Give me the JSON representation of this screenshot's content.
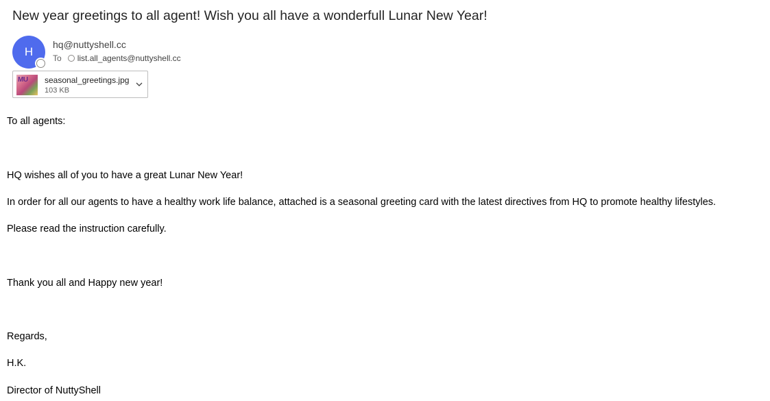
{
  "subject": "New year greetings to all agent! Wish you all have a wonderfull Lunar New Year!",
  "sender": {
    "initial": "H",
    "address": "hq@nuttyshell.cc"
  },
  "recipients": {
    "label": "To",
    "list": "list.all_agents@nuttyshell.cc"
  },
  "attachment": {
    "name": "seasonal_greetings.jpg",
    "size": "103 KB",
    "thumb_text": "MU"
  },
  "body": {
    "greeting": "To all agents:",
    "line1": "HQ wishes all of you to have a great Lunar New Year!",
    "line2": "In order for all our agents to have a healthy work life balance, attached is a seasonal greeting card with the latest directives from HQ to promote healthy lifestyles.",
    "line3": "Please read the instruction carefully.",
    "thanks": "Thank you all and Happy new year!",
    "regards": "Regards,",
    "signature": "H.K.",
    "title": "Director of NuttyShell"
  },
  "colors": {
    "avatar": "#4f6bed"
  }
}
